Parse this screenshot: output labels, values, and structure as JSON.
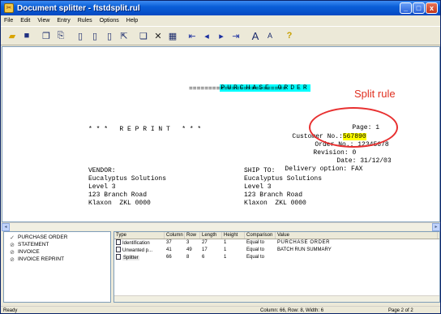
{
  "window": {
    "title": "Document splitter - ftstdsplit.rul",
    "controls": [
      "_",
      "□",
      "x"
    ]
  },
  "menu": [
    "File",
    "Edit",
    "View",
    "Entry",
    "Rules",
    "Options",
    "Help"
  ],
  "toolbar_icons": [
    "open-icon",
    "save-icon",
    "copy-icon",
    "paste-icon",
    "page-icon",
    "page2-icon",
    "page3-icon",
    "page4-icon",
    "cursor-icon",
    "copy2-icon",
    "delete-icon",
    "props-icon",
    "first-icon",
    "prev-icon",
    "next-icon",
    "last-icon",
    "font-larger-icon",
    "font-smaller-icon",
    "help-icon"
  ],
  "document": {
    "title": "PURCHASE ORDER",
    "underline": "=========================",
    "page_label": "Page:",
    "page_value": "1",
    "reprint": "* * *   R E P R I N T   * * *",
    "customer_label": "Customer No.:",
    "customer_value": "567890",
    "order_label": "Order No.:",
    "order_value": "12345678",
    "revision_label": "Revision:",
    "revision_value": "0",
    "date_label": "Date:",
    "date_value": "31/12/03",
    "delivery_label": "Delivery option:",
    "delivery_value": "FAX",
    "vendor_label": "VENDOR:",
    "shipto_label": "SHIP TO:",
    "vendor_lines": [
      "Eucalyptus Solutions",
      "Level 3",
      "123 Branch Road",
      "Klaxon  ZKL 0000"
    ],
    "shipto_lines": [
      "Eucalyptus Solutions",
      "Level 3",
      "123 Branch Road",
      "Klaxon  ZKL 0000"
    ],
    "annotation": "Split rule"
  },
  "tree": {
    "items": [
      {
        "icon": "✓",
        "label": "PURCHASE ORDER"
      },
      {
        "icon": "⊘",
        "label": "STATEMENT"
      },
      {
        "icon": "⊘",
        "label": "INVOICE"
      },
      {
        "icon": "⊘",
        "label": "INVOICE REPRINT"
      }
    ]
  },
  "grid": {
    "headers": [
      "Type",
      "Column",
      "Row",
      "Length",
      "Height",
      "Comparison",
      "Value"
    ],
    "rows": [
      {
        "type": "Identification",
        "column": "37",
        "row": "3",
        "length": "27",
        "height": "1",
        "comparison": "Equal to",
        "value": "PURCHASE ORDER"
      },
      {
        "type": "Unwanted p...",
        "column": "41",
        "row": "49",
        "length": "17",
        "height": "1",
        "comparison": "Equal to",
        "value": "BATCH RUN SUMMARY"
      },
      {
        "type": "Splitter",
        "column": "66",
        "row": "8",
        "length": "6",
        "height": "1",
        "comparison": "Equal to",
        "value": ""
      }
    ]
  },
  "status": {
    "left": "Ready",
    "mid": "Column: 66, Row: 8, Width: 6",
    "right": "Page 2 of 2"
  }
}
